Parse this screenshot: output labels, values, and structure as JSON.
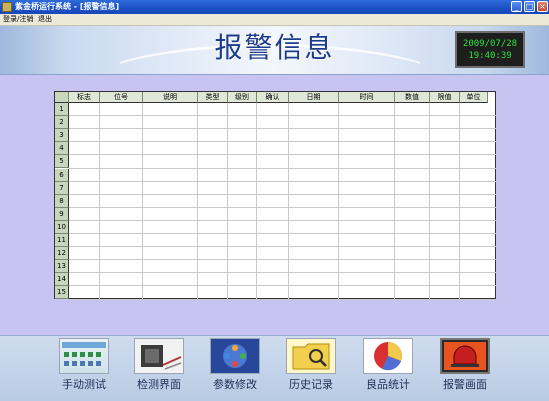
{
  "window": {
    "title": "紫金桥运行系统 - [报警信息]",
    "buttons": [
      "_",
      "□",
      "×"
    ]
  },
  "menu": [
    "登录/注销",
    "退出"
  ],
  "banner": {
    "title": "报警信息"
  },
  "clock": {
    "date": "2009/07/28",
    "time": "19:40:39"
  },
  "table": {
    "columns": [
      "标志",
      "位号",
      "说明",
      "类型",
      "级别",
      "确认",
      "日期",
      "时间",
      "数值",
      "限值",
      "单位"
    ],
    "row_numbers": [
      "1",
      "2",
      "3",
      "4",
      "5",
      "6",
      "7",
      "8",
      "9",
      "10",
      "11",
      "12",
      "13",
      "14",
      "15"
    ]
  },
  "nav": [
    {
      "label": "手动测试",
      "icon": "manual-test-icon"
    },
    {
      "label": "检测界面",
      "icon": "inspection-icon"
    },
    {
      "label": "参数修改",
      "icon": "parameter-icon"
    },
    {
      "label": "历史记录",
      "icon": "history-icon"
    },
    {
      "label": "良品统计",
      "icon": "pie-chart-icon"
    },
    {
      "label": "报警画面",
      "icon": "alarm-icon"
    }
  ],
  "colors": {
    "titlebar": "#1a4fc4",
    "panel": "#c8c4f2",
    "clock_text": "#2fe03c",
    "table_header": "#dfe7d6"
  }
}
